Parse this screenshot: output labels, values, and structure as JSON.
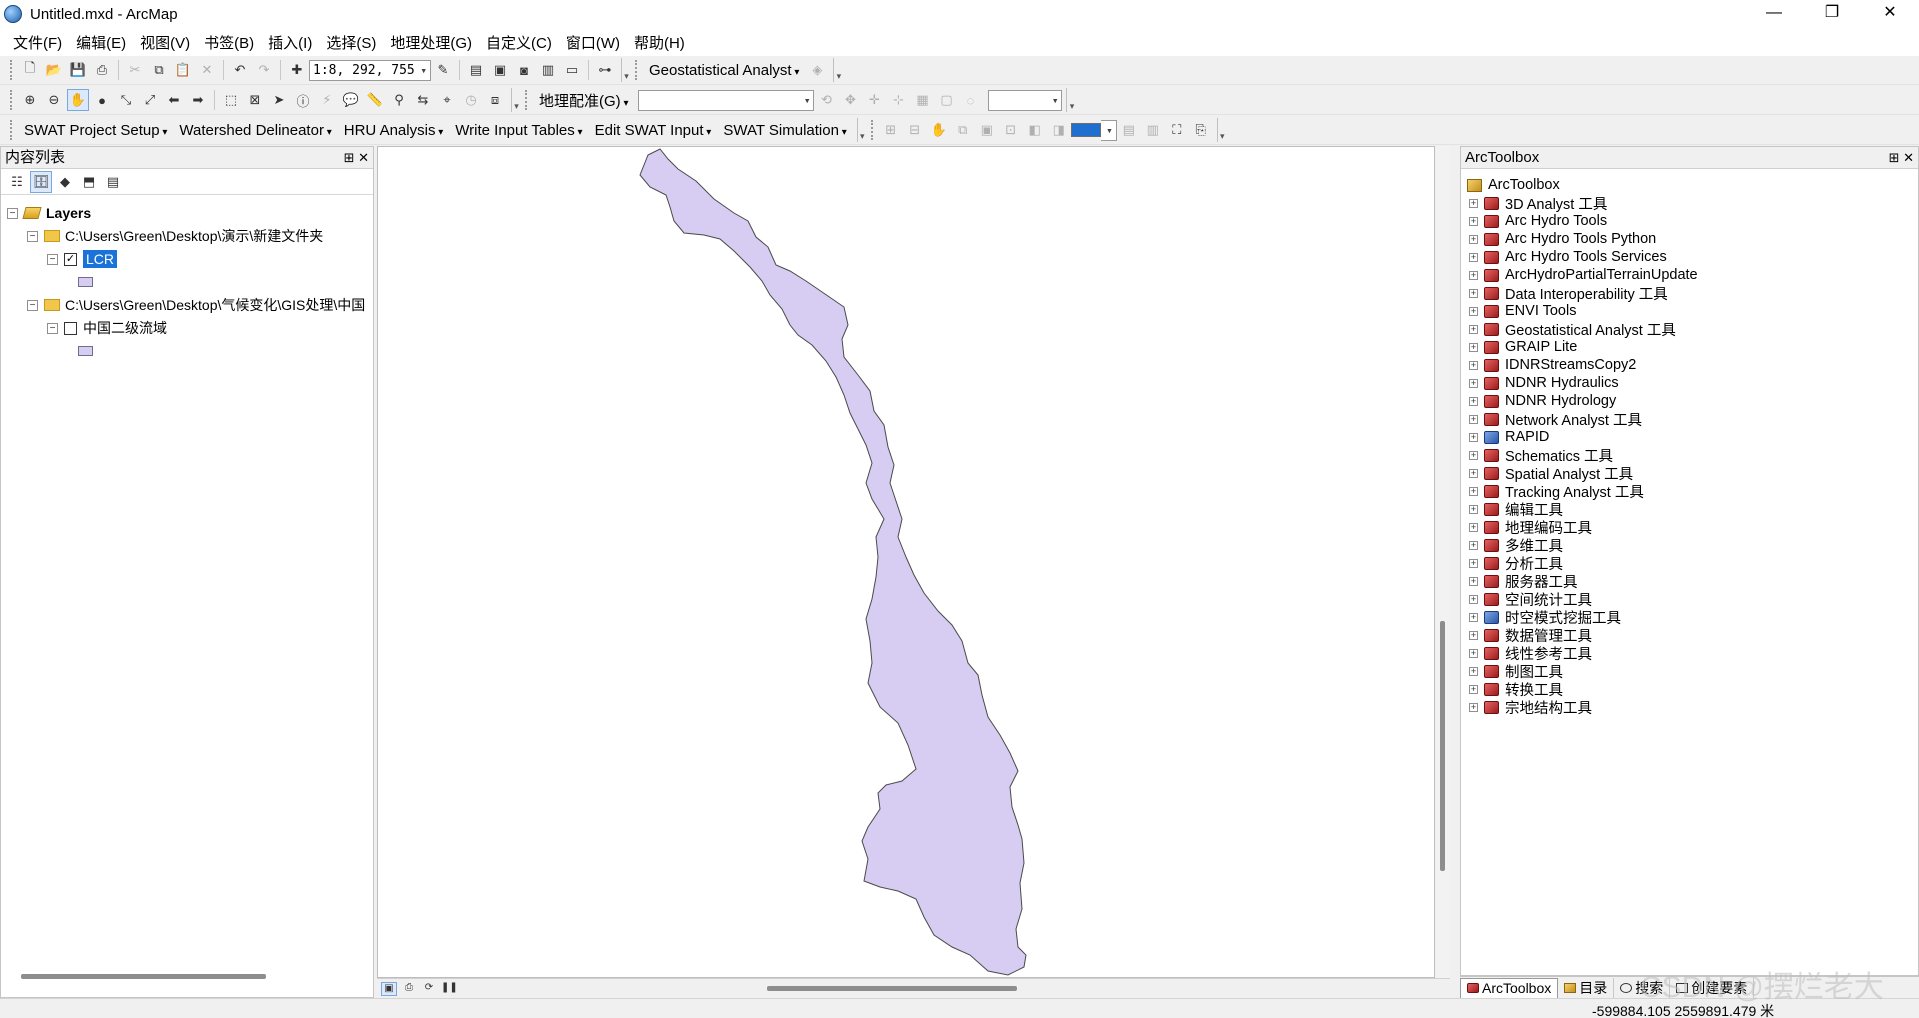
{
  "window": {
    "title": "Untitled.mxd - ArcMap",
    "min": "—",
    "max": "❐",
    "close": "✕"
  },
  "menu": [
    "文件(F)",
    "编辑(E)",
    "视图(V)",
    "书签(B)",
    "插入(I)",
    "选择(S)",
    "地理处理(G)",
    "自定义(C)",
    "窗口(W)",
    "帮助(H)"
  ],
  "toolbar1": {
    "scale": "1:8, 292, 755",
    "geostat": "Geostatistical Analyst"
  },
  "toolbar2": {
    "georef": "地理配准(G)"
  },
  "swat": [
    "SWAT Project Setup",
    "Watershed Delineator",
    "HRU Analysis",
    "Write Input Tables",
    "Edit SWAT Input",
    "SWAT Simulation"
  ],
  "toc": {
    "title": "内容列表",
    "pin": "⊞ ✕",
    "root": "Layers",
    "group1": "C:\\Users\\Green\\Desktop\\演示\\新建文件夹",
    "layer1": "LCR",
    "group2": "C:\\Users\\Green\\Desktop\\气候变化\\GIS处理\\中国",
    "layer2": "中国二级流域"
  },
  "toolbox": {
    "title": "ArcToolbox",
    "pin": "⊞ ✕",
    "root": "ArcToolbox",
    "items": [
      "3D Analyst 工具",
      "Arc Hydro Tools",
      "Arc Hydro Tools Python",
      "Arc Hydro Tools Services",
      "ArcHydroPartialTerrainUpdate",
      "Data Interoperability 工具",
      "ENVI Tools",
      "Geostatistical Analyst 工具",
      "GRAIP Lite",
      "IDNRStreamsCopy2",
      "NDNR Hydraulics",
      "NDNR Hydrology",
      "Network Analyst 工具",
      "RAPID",
      "Schematics 工具",
      "Spatial Analyst 工具",
      "Tracking Analyst 工具",
      "编辑工具",
      "地理编码工具",
      "多维工具",
      "分析工具",
      "服务器工具",
      "空间统计工具",
      "时空模式挖掘工具",
      "数据管理工具",
      "线性参考工具",
      "制图工具",
      "转换工具",
      "宗地结构工具"
    ],
    "tabs": [
      "ArcToolbox",
      "目录",
      "搜索",
      "创建要素"
    ]
  },
  "status": {
    "coords": "-599884.105  2559891.479 米"
  },
  "watermark": "CSDN @摆烂老大",
  "colors": {
    "polygon_fill": "#d7ccf2",
    "polygon_stroke": "#4a4a4a",
    "selection": "#1a73d8"
  }
}
